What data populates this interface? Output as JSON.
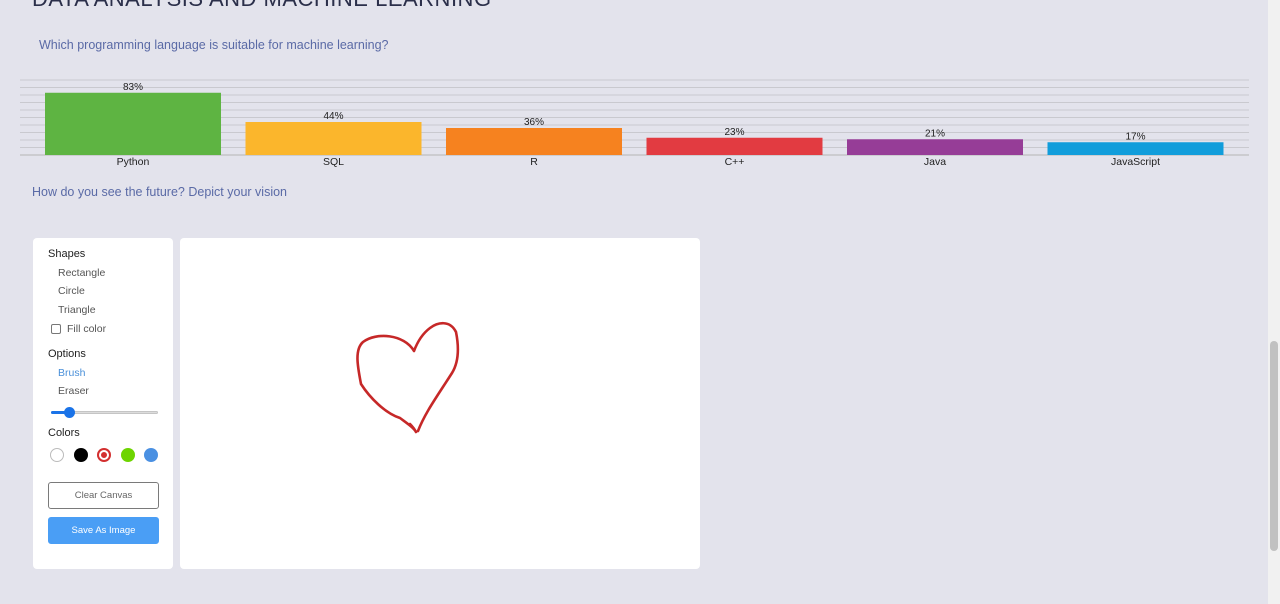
{
  "heading": "DATA ANALYSIS AND MACHINE LEARNING",
  "question1": "Which programming language is suitable for machine learning?",
  "question2": "How do you see the future? Depict your vision",
  "chart_data": {
    "type": "bar",
    "categories": [
      "Python",
      "SQL",
      "R",
      "C++",
      "Java",
      "JavaScript"
    ],
    "values": [
      83,
      44,
      36,
      23,
      21,
      17
    ],
    "data_labels": [
      "83%",
      "44%",
      "36%",
      "23%",
      "21%",
      "17%"
    ],
    "colors": [
      "#5eb442",
      "#fbb62c",
      "#f6821f",
      "#e23b41",
      "#963d97",
      "#119ddb"
    ],
    "ylim": [
      0,
      100
    ],
    "grid": true
  },
  "tools": {
    "shapes_title": "Shapes",
    "shapes": [
      "Rectangle",
      "Circle",
      "Triangle"
    ],
    "fill_label": "Fill color",
    "fill_checked": false,
    "options_title": "Options",
    "brush_label": "Brush",
    "eraser_label": "Eraser",
    "active_option": "Brush",
    "brush_size_fraction": 0.17,
    "colors_title": "Colors",
    "colors": [
      "#ffffff",
      "#000000",
      "#d32f2f",
      "#6dd400",
      "#4a90e2"
    ],
    "selected_color": "#d32f2f",
    "clear_label": "Clear Canvas",
    "save_label": "Save As Image"
  },
  "canvas": {
    "stroke_color": "#c62828"
  }
}
